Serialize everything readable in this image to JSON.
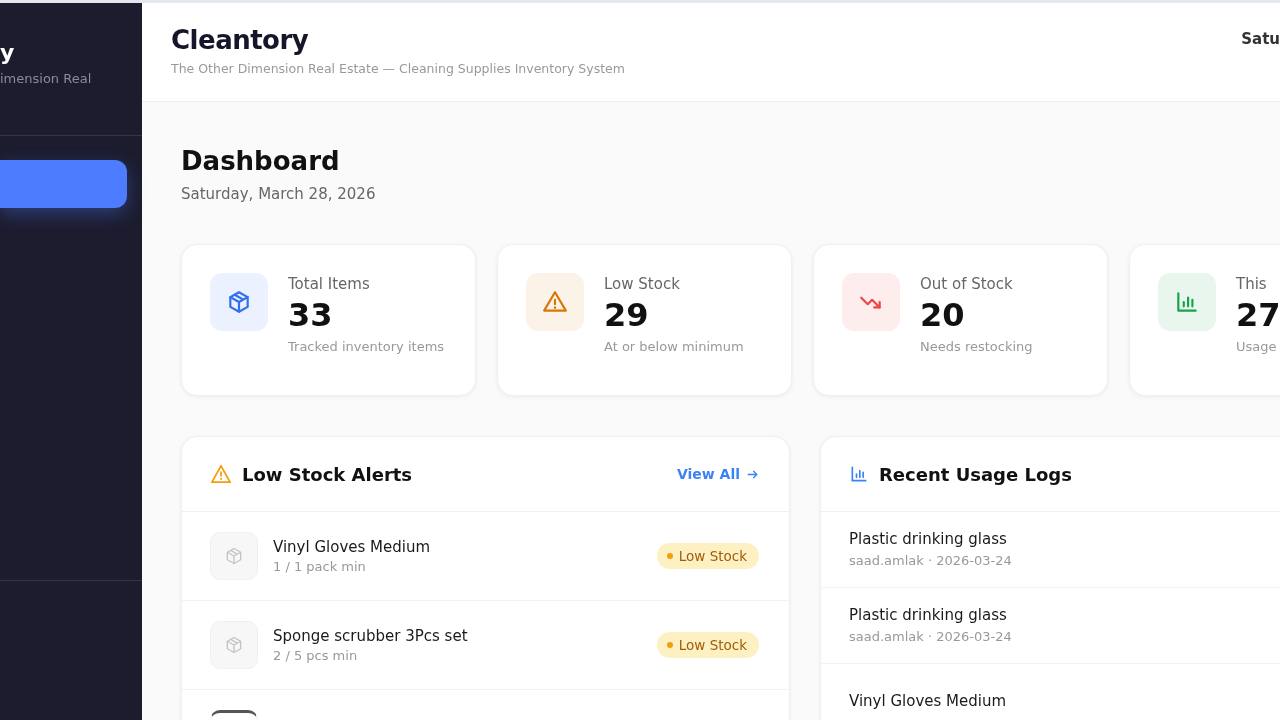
{
  "sidebar": {
    "brand": "y",
    "brand_subtitle": "imension Real",
    "nav": [
      {
        "selected": true
      }
    ]
  },
  "header": {
    "title": "Cleantory",
    "subtitle": "The Other Dimension Real Estate — Cleaning Supplies Inventory System",
    "date": "Satu"
  },
  "page": {
    "title": "Dashboard",
    "date": "Saturday, March 28, 2026"
  },
  "stats": [
    {
      "kind": "box",
      "label": "Total Items",
      "value": "33",
      "note": "Tracked inventory items",
      "color": "#2f6ff0"
    },
    {
      "kind": "warning",
      "label": "Low Stock",
      "value": "29",
      "note": "At or below minimum",
      "color": "#d97706"
    },
    {
      "kind": "trend-down",
      "label": "Out of Stock",
      "value": "20",
      "note": "Needs restocking",
      "color": "#ef4444"
    },
    {
      "kind": "chart",
      "label": "This",
      "value": "27",
      "note": "Usage",
      "color": "#16a34a"
    }
  ],
  "alerts": {
    "title": "Low Stock Alerts",
    "link": "View All",
    "items": [
      {
        "name": "Vinyl Gloves Medium",
        "detail": "1 / 1 pack min",
        "badge": "Low Stock"
      },
      {
        "name": "Sponge scrubber 3Pcs set",
        "detail": "2 / 5 pcs min",
        "badge": "Low Stock"
      }
    ]
  },
  "logs": {
    "title": "Recent Usage Logs",
    "items": [
      {
        "name": "Plastic drinking glass",
        "detail": "saad.amlak · 2026-03-24"
      },
      {
        "name": "Plastic drinking glass",
        "detail": "saad.amlak · 2026-03-24"
      },
      {
        "name": "Vinyl Gloves Medium"
      }
    ]
  }
}
